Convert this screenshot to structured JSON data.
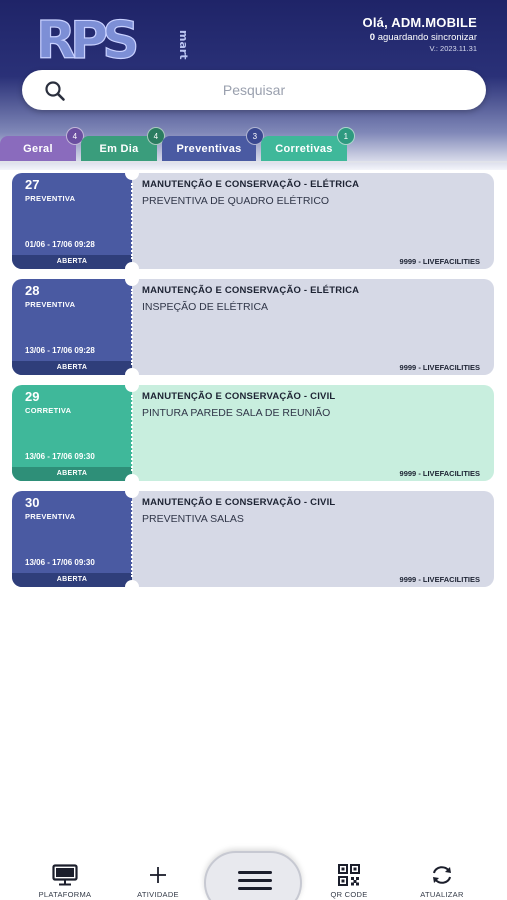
{
  "header": {
    "logo_text": "RPS",
    "logo_sub": "mart",
    "greeting": "Olá, ADM.MOBILE",
    "sync_count": "0",
    "sync_text": " aguardando sincronizar",
    "version": "V.: 2023.11.31"
  },
  "search": {
    "placeholder": "Pesquisar"
  },
  "tabs": [
    {
      "label": "Geral",
      "count": "4",
      "color": "#8a6bbd",
      "badge_color": "#6a4fa0"
    },
    {
      "label": "Em Dia",
      "count": "4",
      "color": "#3a9d7c",
      "badge_color": "#2b7c60"
    },
    {
      "label": "Preventivas",
      "count": "3",
      "color": "#4a5aa2",
      "badge_color": "#3a4890"
    },
    {
      "label": "Corretivas",
      "count": "1",
      "color": "#3fb89a",
      "badge_color": "#2e9a80"
    }
  ],
  "cards": [
    {
      "number": "27",
      "type": "PREVENTIVA",
      "date": "01/06 - 17/06 09:28",
      "status": "ABERTA",
      "category": "MANUTENÇÃO E CONSERVAÇÃO - ELÉTRICA",
      "description": "PREVENTIVA DE QUADRO ELÉTRICO",
      "owner": "9999 - LIVEFACILITIES"
    },
    {
      "number": "28",
      "type": "PREVENTIVA",
      "date": "13/06 - 17/06 09:28",
      "status": "ABERTA",
      "category": "MANUTENÇÃO E CONSERVAÇÃO - ELÉTRICA",
      "description": "INSPEÇÃO DE ELÉTRICA",
      "owner": "9999 - LIVEFACILITIES"
    },
    {
      "number": "29",
      "type": "CORRETIVA",
      "date": "13/06 - 17/06 09:30",
      "status": "ABERTA",
      "category": "MANUTENÇÃO E CONSERVAÇÃO - CIVIL",
      "description": "PINTURA PAREDE SALA DE REUNIÃO",
      "owner": "9999 - LIVEFACILITIES"
    },
    {
      "number": "30",
      "type": "PREVENTIVA",
      "date": "13/06 - 17/06 09:30",
      "status": "ABERTA",
      "category": "MANUTENÇÃO E CONSERVAÇÃO - CIVIL",
      "description": "PREVENTIVA SALAS",
      "owner": "9999 - LIVEFACILITIES"
    }
  ],
  "bottom_nav": {
    "plataforma": "PLATAFORMA",
    "atividade": "ATIVIDADE",
    "qr_code": "QR CODE",
    "atualizar": "ATUALIZAR"
  },
  "icons": {
    "search": "search-icon",
    "plataforma": "monitor-icon",
    "atividade": "plus-icon",
    "menu": "hamburger-menu-icon",
    "qr_code": "qr-code-icon",
    "atualizar": "refresh-icon"
  }
}
